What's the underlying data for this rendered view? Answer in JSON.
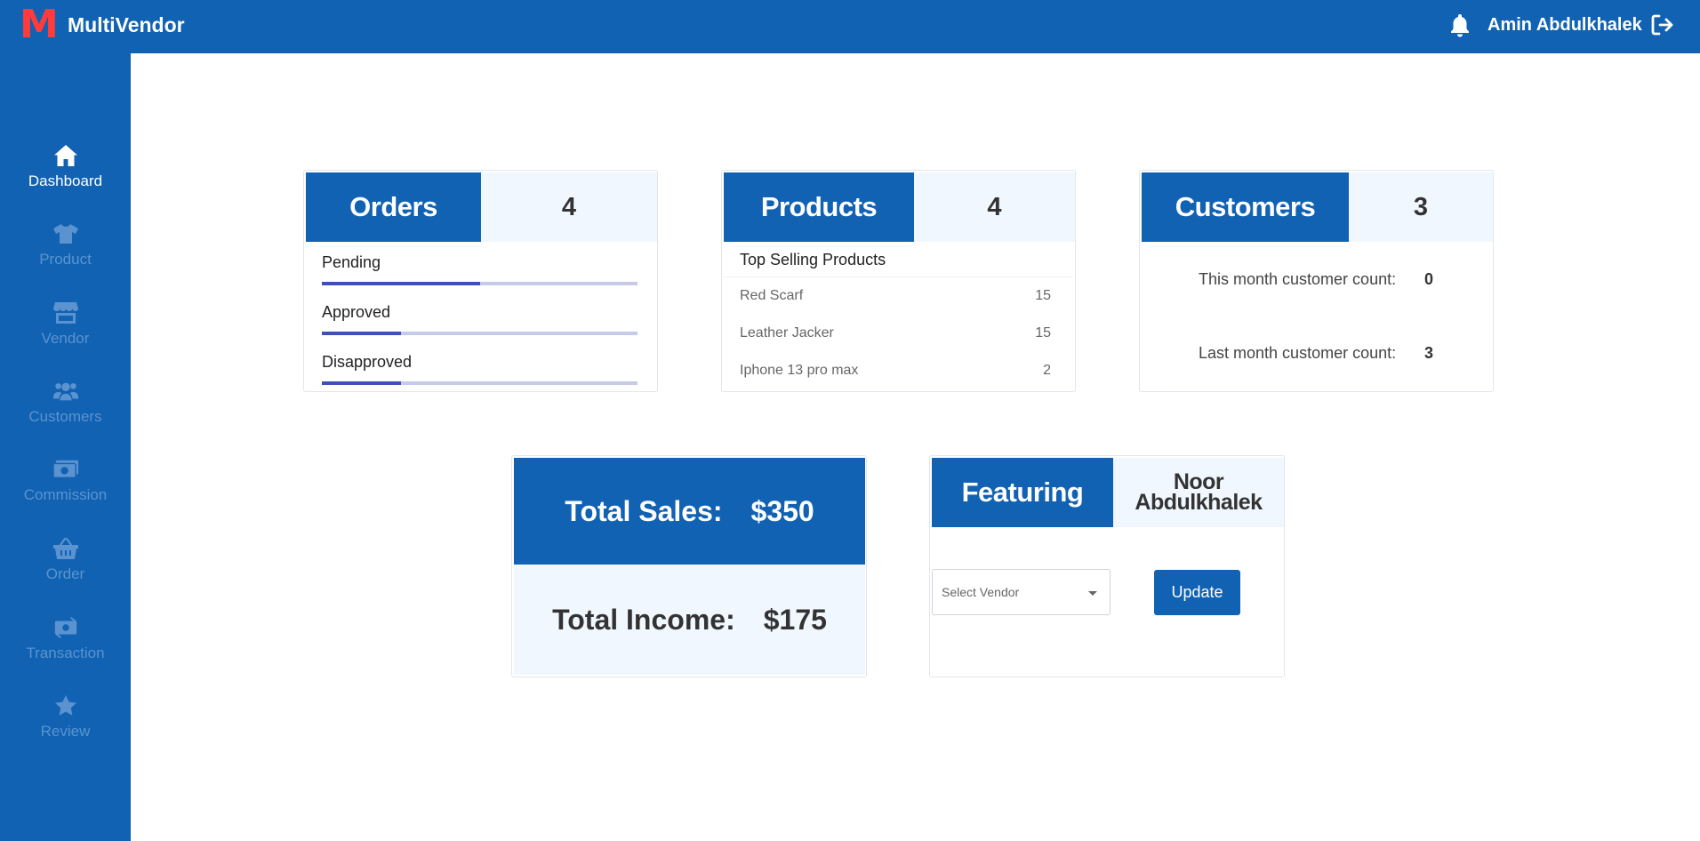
{
  "header": {
    "logo_letter": "M",
    "brand": "MultiVendor",
    "user_name": "Amin Abdulkhalek",
    "bell_icon": "bell-icon",
    "logout_icon": "logout-icon",
    "logo_color": "#ff3b3b",
    "bar_color": "#1162b2"
  },
  "sidebar": {
    "items": [
      {
        "label": "Dashboard",
        "icon": "home-icon",
        "active": true
      },
      {
        "label": "Product",
        "icon": "tshirt-icon"
      },
      {
        "label": "Vendor",
        "icon": "store-icon"
      },
      {
        "label": "Customers",
        "icon": "users-icon"
      },
      {
        "label": "Commission",
        "icon": "money-icon"
      },
      {
        "label": "Order",
        "icon": "basket-icon"
      },
      {
        "label": "Transaction",
        "icon": "money-transfer-icon"
      },
      {
        "label": "Review",
        "icon": "star-icon"
      }
    ]
  },
  "orders": {
    "title": "Orders",
    "count": "4",
    "statuses": [
      {
        "label": "Pending",
        "fraction": 0.5
      },
      {
        "label": "Approved",
        "fraction": 0.25
      },
      {
        "label": "Disapproved",
        "fraction": 0.25
      }
    ]
  },
  "products": {
    "title": "Products",
    "count": "4",
    "top_selling_title": "Top Selling Products",
    "top_selling": [
      {
        "name": "Red Scarf",
        "qty": "15"
      },
      {
        "name": "Leather Jacker",
        "qty": "15"
      },
      {
        "name": "Iphone 13 pro max",
        "qty": "2"
      }
    ]
  },
  "customers": {
    "title": "Customers",
    "count": "3",
    "this_month_label": "This month customer count:",
    "this_month_value": "0",
    "last_month_label": "Last month customer count:",
    "last_month_value": "3"
  },
  "sales": {
    "total_sales_label": "Total Sales:",
    "total_sales_value": "$350",
    "total_income_label": "Total Income:",
    "total_income_value": "$175"
  },
  "featuring": {
    "title": "Featuring",
    "vendor_name": "Noor Abdulkhalek",
    "select_placeholder": "Select Vendor",
    "update_label": "Update"
  }
}
